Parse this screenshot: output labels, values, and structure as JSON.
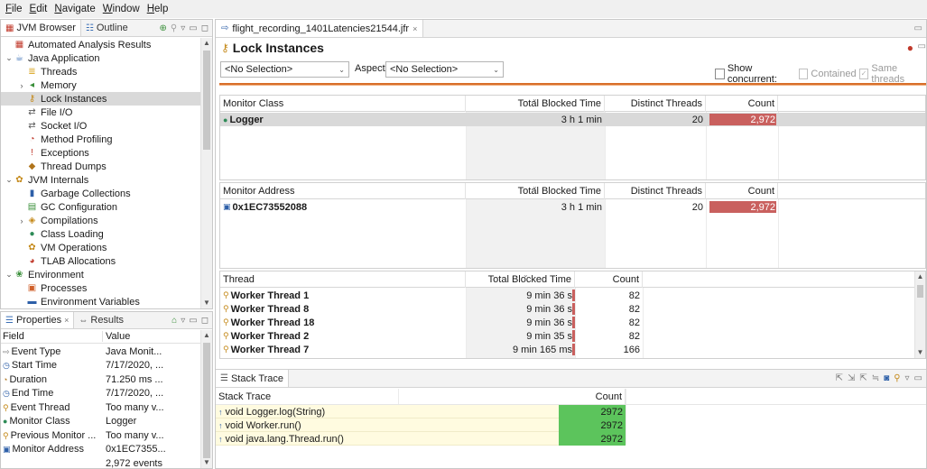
{
  "menu": {
    "items": [
      {
        "label": "File",
        "u": "F",
        "rest": "ile"
      },
      {
        "label": "Edit",
        "u": "E",
        "rest": "dit"
      },
      {
        "label": "Navigate",
        "u": "N",
        "rest": "avigate"
      },
      {
        "label": "Window",
        "u": "W",
        "rest": "indow"
      },
      {
        "label": "Help",
        "u": "H",
        "rest": "elp"
      }
    ]
  },
  "left_top": {
    "tab_active": "JVM Browser",
    "tab_inactive": "Outline",
    "tree": [
      {
        "label": "Automated Analysis Results",
        "level": 0,
        "twisty": "",
        "icon": "report-icon",
        "glyph": "▦",
        "color": "#c0392b"
      },
      {
        "label": "Java Application",
        "level": 0,
        "twisty": "v",
        "icon": "java-app-icon",
        "glyph": "☕",
        "color": "#3b6fb6"
      },
      {
        "label": "Threads",
        "level": 1,
        "twisty": "",
        "icon": "threads-icon",
        "glyph": "≣",
        "color": "#d9a521"
      },
      {
        "label": "Memory",
        "level": 1,
        "twisty": ">",
        "icon": "memory-icon",
        "glyph": "◂",
        "color": "#3a8f3a"
      },
      {
        "label": "Lock Instances",
        "level": 1,
        "twisty": "",
        "icon": "lock-icon",
        "glyph": "⚷",
        "color": "#c58a1b",
        "selected": true
      },
      {
        "label": "File I/O",
        "level": 1,
        "twisty": "",
        "icon": "file-io-icon",
        "glyph": "⇄",
        "color": "#5a5a5a"
      },
      {
        "label": "Socket I/O",
        "level": 1,
        "twisty": "",
        "icon": "socket-io-icon",
        "glyph": "⇄",
        "color": "#5a5a5a"
      },
      {
        "label": "Method Profiling",
        "level": 1,
        "twisty": "",
        "icon": "method-profiling-icon",
        "glyph": "◔",
        "color": "#c0392b"
      },
      {
        "label": "Exceptions",
        "level": 1,
        "twisty": "",
        "icon": "exceptions-icon",
        "glyph": "!",
        "color": "#c0392b"
      },
      {
        "label": "Thread Dumps",
        "level": 1,
        "twisty": "",
        "icon": "thread-dumps-icon",
        "glyph": "◆",
        "color": "#b0741b"
      },
      {
        "label": "JVM Internals",
        "level": 0,
        "twisty": "v",
        "icon": "jvm-internals-icon",
        "glyph": "✿",
        "color": "#c58a1b"
      },
      {
        "label": "Garbage Collections",
        "level": 1,
        "twisty": "",
        "icon": "gc-icon",
        "glyph": "▮",
        "color": "#2d5fa8"
      },
      {
        "label": "GC Configuration",
        "level": 1,
        "twisty": "",
        "icon": "gc-config-icon",
        "glyph": "▤",
        "color": "#3a8f3a"
      },
      {
        "label": "Compilations",
        "level": 1,
        "twisty": ">",
        "icon": "compilations-icon",
        "glyph": "◈",
        "color": "#c58a1b"
      },
      {
        "label": "Class Loading",
        "level": 1,
        "twisty": "",
        "icon": "class-loading-icon",
        "glyph": "●",
        "color": "#2e8b57"
      },
      {
        "label": "VM Operations",
        "level": 1,
        "twisty": "",
        "icon": "vm-operations-icon",
        "glyph": "✿",
        "color": "#c58a1b"
      },
      {
        "label": "TLAB Allocations",
        "level": 1,
        "twisty": "",
        "icon": "tlab-icon",
        "glyph": "◕",
        "color": "#c0392b"
      },
      {
        "label": "Environment",
        "level": 0,
        "twisty": "v",
        "icon": "environment-icon",
        "glyph": "❀",
        "color": "#3a8f3a"
      },
      {
        "label": "Processes",
        "level": 1,
        "twisty": "",
        "icon": "processes-icon",
        "glyph": "▣",
        "color": "#d0602a"
      },
      {
        "label": "Environment Variables",
        "level": 1,
        "twisty": "",
        "icon": "env-vars-icon",
        "glyph": "▬",
        "color": "#2d5fa8"
      }
    ]
  },
  "properties": {
    "tab_active": "Properties",
    "tab_inactive": "Results",
    "col_field": "Field",
    "col_value": "Value",
    "rows": [
      {
        "field": "Event Type",
        "value": "Java Monit...",
        "icon": "event-type-icon",
        "glyph": "⇨",
        "color": "#7a7a7a"
      },
      {
        "field": "Start Time",
        "value": "7/17/2020, ...",
        "icon": "clock-icon",
        "glyph": "◷",
        "color": "#2d5fa8"
      },
      {
        "field": "Duration",
        "value": "71.250 ms ...",
        "icon": "duration-icon",
        "glyph": "◔",
        "color": "#b0741b"
      },
      {
        "field": "End Time",
        "value": "7/17/2020, ...",
        "icon": "clock-icon",
        "glyph": "◷",
        "color": "#2d5fa8"
      },
      {
        "field": "Event Thread",
        "value": "Too many v...",
        "icon": "thread-icon",
        "glyph": "⚲",
        "color": "#c58a1b"
      },
      {
        "field": "Monitor Class",
        "value": "Logger",
        "icon": "class-icon",
        "glyph": "●",
        "color": "#2e8b57"
      },
      {
        "field": "Previous Monitor ...",
        "value": "Too many v...",
        "icon": "thread-icon",
        "glyph": "⚲",
        "color": "#c58a1b"
      },
      {
        "field": "Monitor Address",
        "value": "0x1EC7355...",
        "icon": "address-icon",
        "glyph": "▣",
        "color": "#2d5fa8"
      },
      {
        "field": "",
        "value": "2,972 events",
        "icon": "",
        "glyph": "",
        "color": "#000"
      }
    ]
  },
  "editor": {
    "tab_label": "flight_recording_1401Latencies21544.jfr",
    "title": "Lock Instances",
    "selection_combo": "<No Selection>",
    "aspect_label": "Aspect:",
    "aspect_combo": "<No Selection>",
    "show_concurrent": "Show concurrent:",
    "contained": "Contained",
    "same_threads": "Same threads",
    "monitor_class_table": {
      "headers": [
        "Monitor Class",
        "Total Blocked Time",
        "Distinct Threads",
        "Count"
      ],
      "rows": [
        {
          "name": "Logger",
          "time": "3 h 1 min",
          "threads": "20",
          "count": "2,972"
        }
      ]
    },
    "monitor_address_table": {
      "headers": [
        "Monitor Address",
        "Total Blocked Time",
        "Distinct Threads",
        "Count"
      ],
      "rows": [
        {
          "name": "0x1EC73552088",
          "time": "3 h 1 min",
          "threads": "20",
          "count": "2,972"
        }
      ]
    },
    "thread_table": {
      "headers": [
        "Thread",
        "Total Blocked Time",
        "Count"
      ],
      "rows": [
        {
          "name": "Worker Thread 1",
          "time": "9 min 36 s",
          "count": "82"
        },
        {
          "name": "Worker Thread 8",
          "time": "9 min 36 s",
          "count": "82"
        },
        {
          "name": "Worker Thread 18",
          "time": "9 min 36 s",
          "count": "82"
        },
        {
          "name": "Worker Thread 2",
          "time": "9 min 35 s",
          "count": "82"
        },
        {
          "name": "Worker Thread 7",
          "time": "9 min 165 ms",
          "count": "166"
        }
      ]
    },
    "stack_trace": {
      "tab_label": "Stack Trace",
      "headers": [
        "Stack Trace",
        "Count"
      ],
      "rows": [
        {
          "frame": "void Logger.log(String)",
          "count": "2972"
        },
        {
          "frame": "void Worker.run()",
          "count": "2972"
        },
        {
          "frame": "void java.lang.Thread.run()",
          "count": "2972"
        }
      ]
    }
  },
  "colors": {
    "count_bar": "#c9605e",
    "stack_count_bar": "#5cc45c",
    "accent_orange": "#d86f2a",
    "selection_gray": "#d9d9d9"
  }
}
